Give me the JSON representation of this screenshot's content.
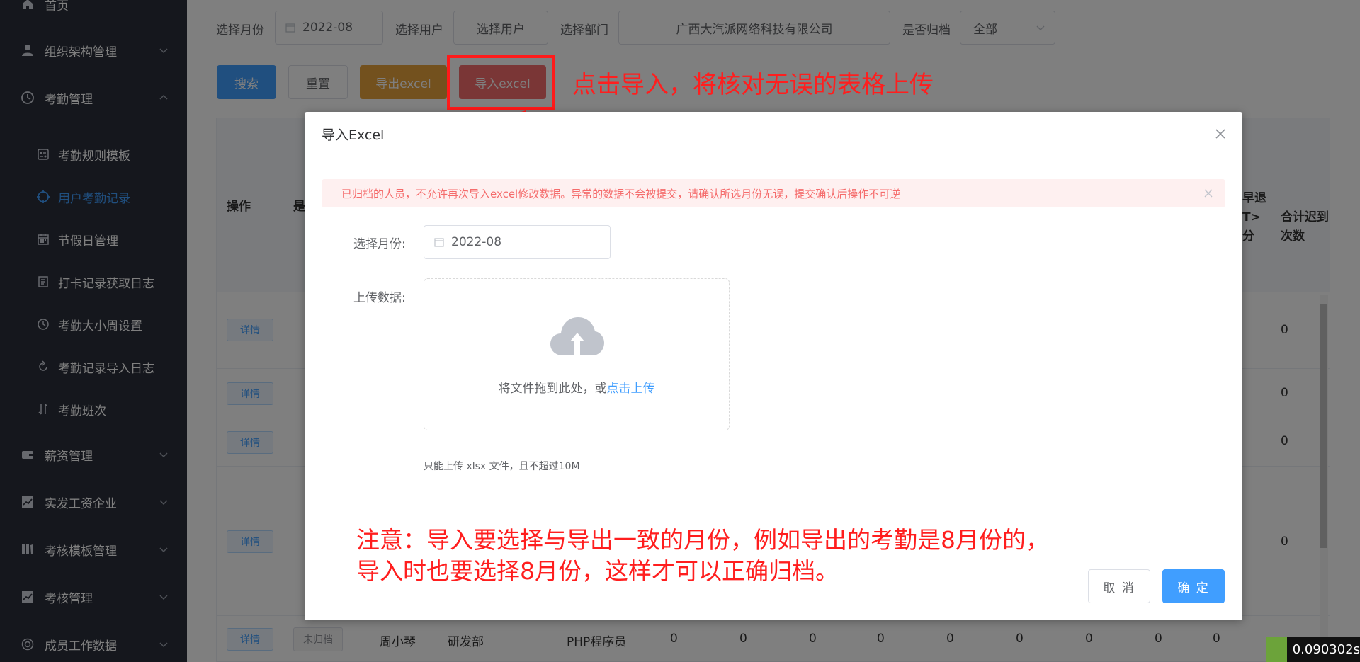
{
  "sidebar": {
    "items": [
      {
        "label": "首页",
        "icon": "home-icon"
      },
      {
        "label": "组织架构管理",
        "icon": "user-icon"
      },
      {
        "label": "考勤管理",
        "icon": "clock-icon"
      },
      {
        "label": "薪资管理",
        "icon": "wallet-icon"
      },
      {
        "label": "实发工资企业",
        "icon": "chart-icon"
      },
      {
        "label": "考核模板管理",
        "icon": "template-icon"
      },
      {
        "label": "考核管理",
        "icon": "chart-icon"
      },
      {
        "label": "成员工作数据",
        "icon": "data-icon"
      }
    ],
    "sub_items": [
      {
        "label": "考勤规则模板",
        "icon": "rules-icon"
      },
      {
        "label": "用户考勤记录",
        "icon": "compass-icon",
        "active": true
      },
      {
        "label": "节假日管理",
        "icon": "calendar-icon"
      },
      {
        "label": "打卡记录获取日志",
        "icon": "document-icon"
      },
      {
        "label": "考勤大小周设置",
        "icon": "clock-icon"
      },
      {
        "label": "考勤记录导入日志",
        "icon": "refresh-icon"
      },
      {
        "label": "考勤班次",
        "icon": "sort-icon"
      }
    ]
  },
  "filters": {
    "month_label": "选择月份",
    "month_value": "2022-08",
    "user_label": "选择用户",
    "user_placeholder": "选择用户",
    "dept_label": "选择部门",
    "dept_value": "广西大汽派网络科技有限公司",
    "archived_label": "是否归档",
    "archived_value": "全部"
  },
  "toolbar": {
    "search": "搜索",
    "reset": "重置",
    "export": "导出excel",
    "import": "导入excel"
  },
  "annotation": {
    "callout": "点击导入，将核对无误的表格上传",
    "note_line1": "注意：导入要选择与导出一致的月份，例如导出的考勤是8月份的，",
    "note_line2": "导入时也要选择8月份，这样才可以正确归档。"
  },
  "table": {
    "headers": {
      "action": "操作",
      "archived_partial": "是",
      "early_partial_1": "早退",
      "early_partial_2": "T>",
      "early_partial_3": "分",
      "late_total_1": "合计迟到",
      "late_total_2": "次数"
    },
    "detail_label": "详情",
    "rows": [
      {
        "late_total": "0"
      },
      {
        "late_total": "0"
      },
      {
        "late_total": "0"
      },
      {
        "late_total": "0"
      },
      {
        "tag": "未归档",
        "name": "周小琴",
        "dept": "研发部",
        "position": "PHP程序员",
        "values": [
          "0",
          "0",
          "0",
          "0",
          "0",
          "0",
          "0",
          "0",
          "0"
        ]
      }
    ]
  },
  "dialog": {
    "title": "导入Excel",
    "alert": "已归档的人员，不允许再次导入excel修改数据。异常的数据不会被提交，请确认所选月份无误，提交确认后操作不可逆",
    "month_label": "选择月份:",
    "month_value": "2022-08",
    "upload_label": "上传数据:",
    "upload_text": "将文件拖到此处，或",
    "upload_link": "点击上传",
    "tip": "只能上传 xlsx 文件，且不超过10M",
    "cancel": "取 消",
    "confirm": "确 定"
  },
  "timer": "0.090302s",
  "colors": {
    "primary": "#409eff",
    "warning": "#e6a23c",
    "danger": "#f56c6c",
    "annotation": "#ff1e1e",
    "sidebar": "#2b2f3a"
  }
}
